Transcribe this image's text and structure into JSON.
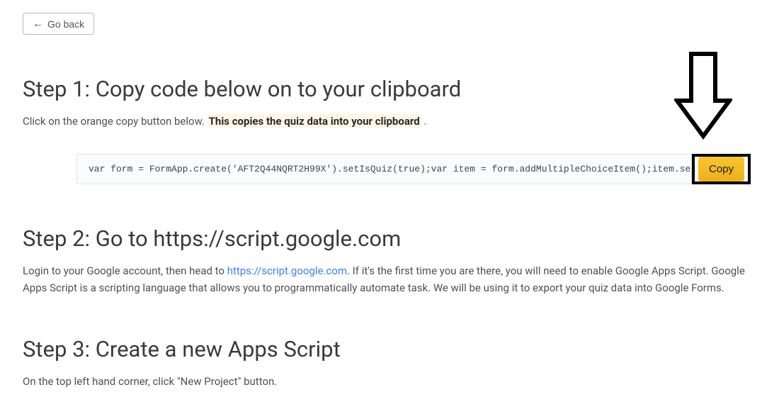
{
  "nav": {
    "go_back_label": "Go back"
  },
  "step1": {
    "heading": "Step 1: Copy code below on to your clipboard",
    "para_prefix": "Click on the orange copy button below.",
    "para_bold": "This copies the quiz data into your clipboard",
    "para_suffix": "."
  },
  "code": {
    "snippet": "var form = FormApp.create('AFT2Q44NQRT2H99X').setIsQuiz(true);var item = form.addMultipleChoiceItem();item.setT",
    "copy_label": "Copy"
  },
  "step2": {
    "heading": "Step 2: Go to https://script.google.com",
    "para_a": "Login to your Google account, then head to ",
    "link_text": "https://script.google.com",
    "link_href": "https://script.google.com",
    "para_b": ". If it's the first time you are there, you will need to enable Google Apps Script. Google Apps Script is a scripting language that allows you to programmatically automate task. We will be using it to export your quiz data into Google Forms."
  },
  "step3": {
    "heading": "Step 3: Create a new Apps Script",
    "para": "On the top left hand corner, click \"New Project\" button."
  }
}
